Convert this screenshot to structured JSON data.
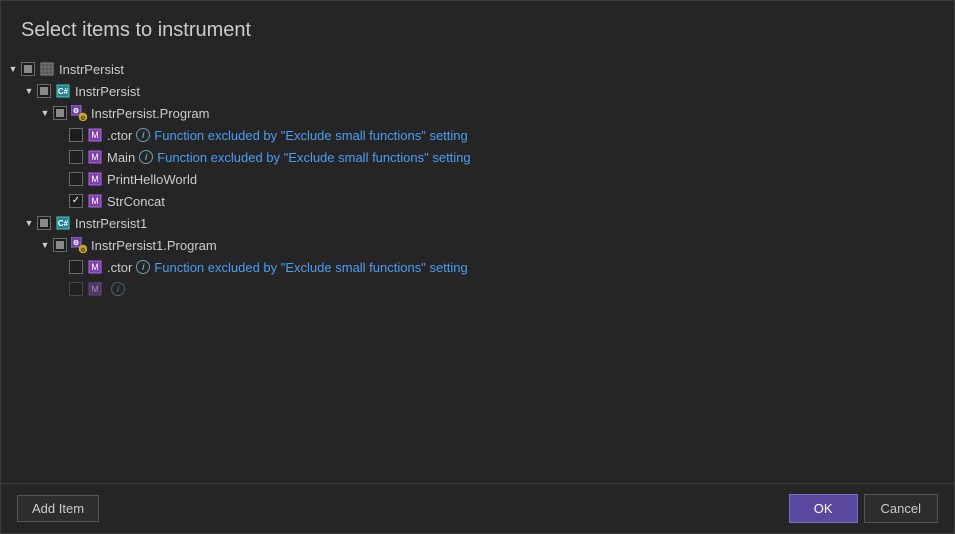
{
  "dialog": {
    "title": "Select items to instrument",
    "tree": [
      {
        "id": "instrpersist-root",
        "label": "InstrPersist",
        "indent": 0,
        "iconType": "assembly",
        "expandState": "expanded",
        "checkState": "indeterminate"
      },
      {
        "id": "instrpersist-assembly",
        "label": "InstrPersist",
        "indent": 1,
        "iconType": "cs-assembly",
        "expandState": "expanded",
        "checkState": "indeterminate"
      },
      {
        "id": "instrpersist-program-ns",
        "label": "InstrPersist.Program",
        "indent": 2,
        "iconType": "ns-gear",
        "expandState": "expanded",
        "checkState": "indeterminate"
      },
      {
        "id": "ctor-1",
        "label": ".ctor",
        "indent": 3,
        "iconType": "method",
        "expandState": "leaf",
        "checkState": "unchecked",
        "hasInfo": true,
        "excludedText": "Function excluded by \"Exclude small functions\" setting"
      },
      {
        "id": "main-1",
        "label": "Main",
        "indent": 3,
        "iconType": "method",
        "expandState": "leaf",
        "checkState": "unchecked",
        "hasInfo": true,
        "excludedText": "Function excluded by \"Exclude small functions\" setting"
      },
      {
        "id": "printhelloworld-1",
        "label": "PrintHelloWorld",
        "indent": 3,
        "iconType": "method",
        "expandState": "leaf",
        "checkState": "unchecked"
      },
      {
        "id": "strconcat-1",
        "label": "StrConcat",
        "indent": 3,
        "iconType": "method",
        "expandState": "leaf",
        "checkState": "checked"
      },
      {
        "id": "instrpersist1-assembly",
        "label": "InstrPersist1",
        "indent": 1,
        "iconType": "cs-assembly",
        "expandState": "expanded",
        "checkState": "indeterminate"
      },
      {
        "id": "instrpersist1-program-ns",
        "label": "InstrPersist1.Program",
        "indent": 2,
        "iconType": "ns-gear",
        "expandState": "expanded",
        "checkState": "indeterminate"
      },
      {
        "id": "ctor-2",
        "label": ".ctor",
        "indent": 3,
        "iconType": "method",
        "expandState": "leaf",
        "checkState": "unchecked",
        "hasInfo": true,
        "excludedText": "Function excluded by \"Exclude small functions\" setting"
      },
      {
        "id": "main-2",
        "label": "...",
        "indent": 3,
        "iconType": "method",
        "expandState": "leaf",
        "checkState": "unchecked",
        "hasInfo": true,
        "excludedText": ""
      }
    ],
    "footer": {
      "addItemLabel": "Add Item",
      "okLabel": "OK",
      "cancelLabel": "Cancel"
    }
  }
}
